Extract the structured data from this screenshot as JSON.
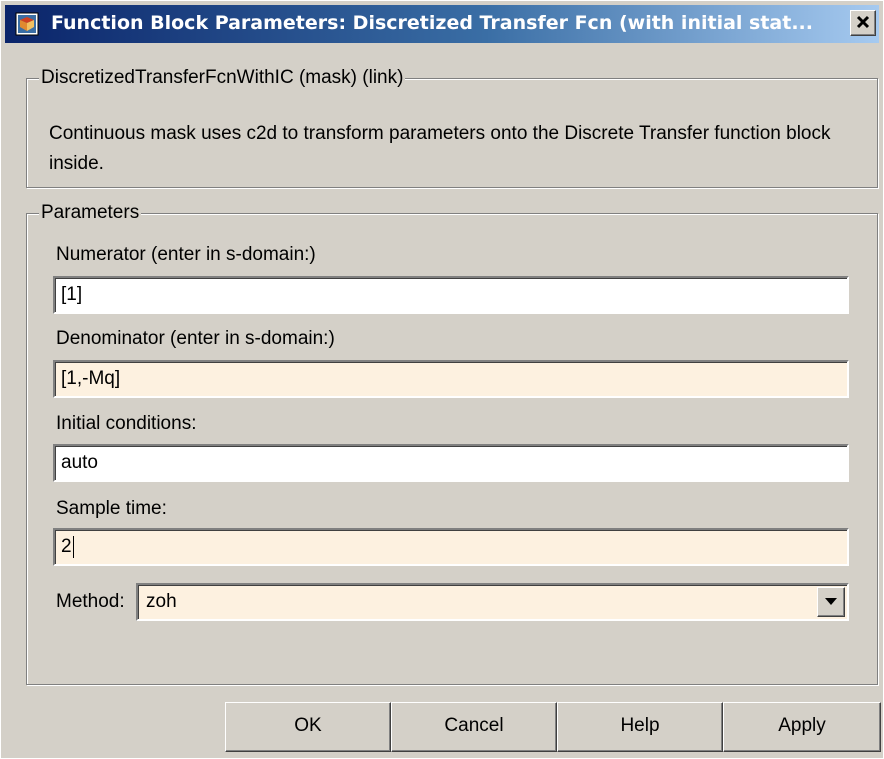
{
  "window": {
    "title": "Function Block Parameters: Discretized Transfer Fcn (with initial stat...",
    "close_glyph": "✕"
  },
  "mask_group": {
    "legend": "DiscretizedTransferFcnWithIC (mask) (link)",
    "description": "Continuous mask uses c2d to transform parameters onto the Discrete Transfer function block inside."
  },
  "params_group": {
    "legend": "Parameters",
    "numerator": {
      "label": "Numerator (enter in s-domain:)",
      "value": "[1]"
    },
    "denominator": {
      "label": "Denominator (enter in s-domain:)",
      "value": "[1,-Mq]"
    },
    "initial_conditions": {
      "label": "Initial conditions:",
      "value": "auto"
    },
    "sample_time": {
      "label": "Sample time:",
      "value": "2"
    },
    "method": {
      "label": "Method:",
      "value": "zoh"
    }
  },
  "buttons": {
    "ok": "OK",
    "cancel": "Cancel",
    "help": "Help",
    "apply": "Apply"
  },
  "colors": {
    "title_gradient_start": "#0a246a",
    "title_gradient_end": "#a6caf0",
    "dialog_face": "#d4d0c8",
    "tinted_field": "#fdf1e0"
  },
  "icons": [
    "simulink-block-icon",
    "close-icon",
    "dropdown-arrow-icon"
  ]
}
